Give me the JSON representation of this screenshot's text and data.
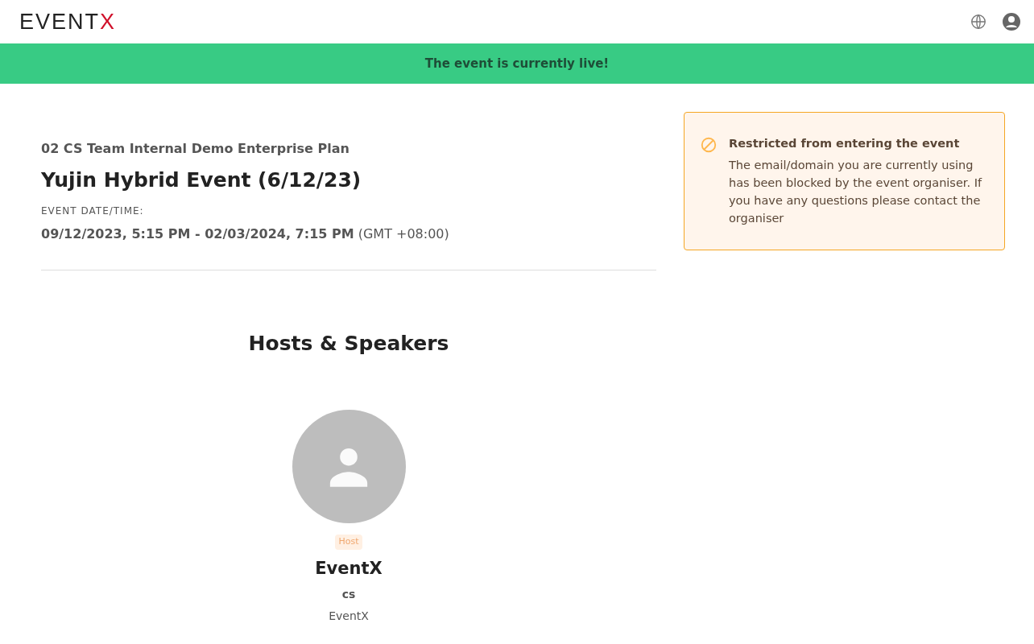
{
  "header": {
    "logo": {
      "text": "EVENT",
      "accent": "X"
    }
  },
  "banner": {
    "text": "The event is currently live!"
  },
  "event": {
    "organizer": "02 CS Team Internal Demo Enterprise Plan",
    "title": "Yujin Hybrid Event (6/12/23)",
    "date_label": "EVENT DATE/TIME:",
    "date_value": "**09/12/2023, 5:15 PM - 02/03/2024, 7:15 PM** (GMT +08:00)"
  },
  "speakers": {
    "heading": "Hosts & Speakers",
    "items": [
      {
        "badge": "Host",
        "name": "EventX",
        "role": "cs",
        "company": "EventX"
      }
    ]
  },
  "notice": {
    "title": "Restricted from entering the event",
    "message": "The email/domain you are currently using has been blocked by the event organiser. If you have any questions please contact the organiser"
  }
}
